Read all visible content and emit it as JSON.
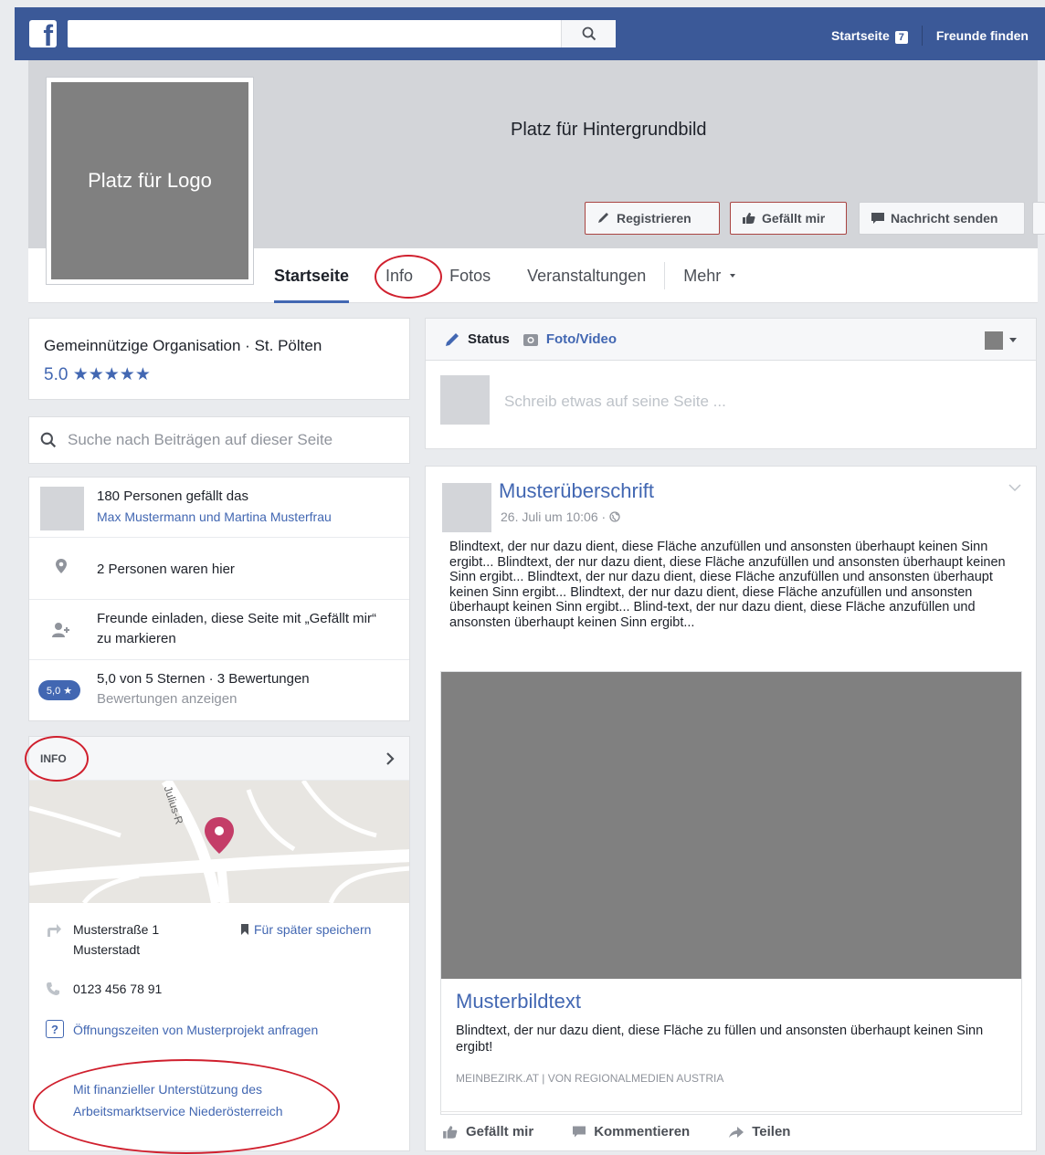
{
  "topbar": {
    "logo_letter": "f",
    "search_placeholder": "",
    "home_label": "Startseite",
    "home_badge": "7",
    "find_friends_label": "Freunde finden"
  },
  "cover": {
    "background_text": "Platz für Hintergrundbild",
    "logo_text": "Platz für Logo",
    "buttons": {
      "register": "Registrieren",
      "like": "Gefällt mir",
      "message": "Nachricht senden"
    }
  },
  "nav": {
    "tabs": [
      "Startseite",
      "Info",
      "Fotos",
      "Veranstaltungen",
      "Mehr"
    ],
    "active": "Startseite"
  },
  "category": {
    "line": "Gemeinnützige Organisation · St. Pölten",
    "rating": "5.0",
    "stars": "★★★★★"
  },
  "page_search": {
    "placeholder": "Suche nach Beiträgen auf dieser Seite"
  },
  "stats": {
    "likes": "180 Personen gefällt das",
    "likes_names": "Max Mustermann und Martina Musterfrau",
    "checkins": "2 Personen waren hier",
    "invite_line1": "Freunde einladen, diese Seite mit „Gefällt mir“",
    "invite_line2": "zu markieren",
    "rating_badge": "5,0 ★",
    "rating_summary": "5,0 von 5 Sternen · 3 Bewertungen",
    "rating_link": "Bewertungen anzeigen"
  },
  "info": {
    "title": "INFO",
    "map_street": "Julius-R",
    "street": "Musterstraße 1",
    "city": "Musterstadt",
    "save_label": "Für später speichern",
    "phone": "0123 456 78 91",
    "hours_link": "Öffnungszeiten von Musterprojekt anfragen",
    "support_line1": "Mit finanzieller Unterstützung des",
    "support_line2": "Arbeitsmarktservice Niederösterreich"
  },
  "composer": {
    "status_label": "Status",
    "photo_label": "Foto/Video",
    "placeholder": "Schreib etwas auf seine Seite ..."
  },
  "post": {
    "title": "Musterüberschrift",
    "date": "26. Juli um 10:06 ·",
    "body": "Blindtext, der nur dazu dient, diese Fläche anzufüllen und ansonsten überhaupt keinen Sinn ergibt... Blindtext, der nur dazu dient, diese Fläche anzufüllen und ansonsten überhaupt keinen Sinn ergibt... Blindtext, der nur dazu dient, diese Fläche anzufüllen und ansonsten überhaupt keinen Sinn ergibt... Blindtext, der nur dazu dient, diese Fläche anzufüllen und ansonsten überhaupt keinen Sinn ergibt... Blind-text, der nur dazu dient, diese Fläche anzufüllen und ansonsten überhaupt keinen Sinn ergibt...",
    "link_title": "Musterbildtext",
    "link_desc": "Blindtext, der nur dazu dient, diese Fläche zu füllen und ansonsten überhaupt keinen Sinn ergibt!",
    "link_source": "MEINBEZIRK.AT | VON REGIONALMEDIEN AUSTRIA",
    "actions": {
      "like": "Gefällt mir",
      "comment": "Kommentieren",
      "share": "Teilen"
    }
  },
  "colors": {
    "brand": "#3b5998",
    "link": "#4267b2",
    "highlight": "#d0202e"
  }
}
